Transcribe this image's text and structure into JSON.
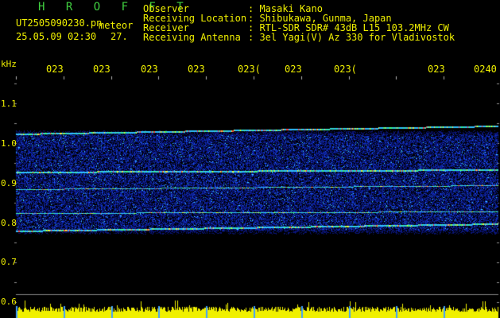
{
  "header": {
    "title": "H R O F F T",
    "filename": "UT2505090230.pn",
    "meteor_label": "meteor",
    "timestamp": "25.05.09 02:30",
    "count": "27."
  },
  "info": [
    {
      "label": "Observer",
      "value": ": Masaki Kano"
    },
    {
      "label": "Receiving Location",
      "value": ": Shibukawa, Gunma, Japan"
    },
    {
      "label": "Receiver",
      "value": ": RTL-SDR SDR# 43dB L15 103.2MHz CW"
    },
    {
      "label": "Receiving Antenna",
      "value": ": 3el Yagi(V) Az 330 for Vladivostok"
    }
  ],
  "axis": {
    "unit": "kHz",
    "freq_labels": [
      "1.1",
      "1.0",
      "0.9",
      "0.8",
      "0.7",
      "0.6"
    ],
    "time_labels": [
      "023",
      "023",
      "023",
      "023",
      "023(",
      "023",
      "023(",
      "023",
      "0240"
    ]
  },
  "colors": {
    "text": "#f0f000",
    "title": "#40d040",
    "background": "#000000",
    "noise_base": "#0a1478"
  }
}
